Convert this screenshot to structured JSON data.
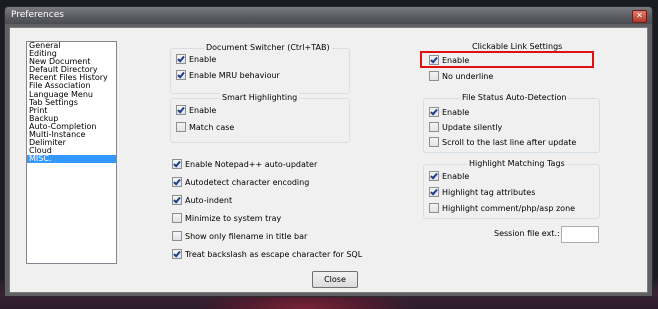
{
  "window": {
    "title": "Preferences"
  },
  "nav": {
    "items": [
      "General",
      "Editing",
      "New Document",
      "Default Directory",
      "Recent Files History",
      "File Association",
      "Language Menu",
      "Tab Settings",
      "Print",
      "Backup",
      "Auto-Completion",
      "Multi-Instance",
      "Delimiter",
      "Cloud",
      "MISC."
    ],
    "selected": "MISC."
  },
  "document_switcher": {
    "title": "Document Switcher (Ctrl+TAB)",
    "enable": "Enable",
    "mru": "Enable MRU behaviour"
  },
  "smart_highlighting": {
    "title": "Smart Highlighting",
    "enable": "Enable",
    "match_case": "Match case"
  },
  "misc_options": {
    "auto_updater": "Enable Notepad++ auto-updater",
    "autodetect_encoding": "Autodetect character encoding",
    "auto_indent": "Auto-indent",
    "minimize_tray": "Minimize to system tray",
    "filename_title": "Show only filename in title bar",
    "backslash_sql": "Treat backslash as escape character for SQL"
  },
  "clickable_link": {
    "title": "Clickable Link Settings",
    "enable": "Enable",
    "no_underline": "No underline"
  },
  "file_status": {
    "title": "File Status Auto-Detection",
    "enable": "Enable",
    "silently": "Update silently",
    "scroll_last": "Scroll to the last line after update"
  },
  "highlight_tags": {
    "title": "Highlight Matching Tags",
    "enable": "Enable",
    "tag_attrs": "Highlight tag attributes",
    "comment_zone": "Highlight comment/php/asp zone"
  },
  "session": {
    "label": "Session file ext.:",
    "value": ""
  },
  "buttons": {
    "close": "Close"
  },
  "colors": {
    "selection": "#3399ff",
    "highlight_box": "#e01010"
  }
}
